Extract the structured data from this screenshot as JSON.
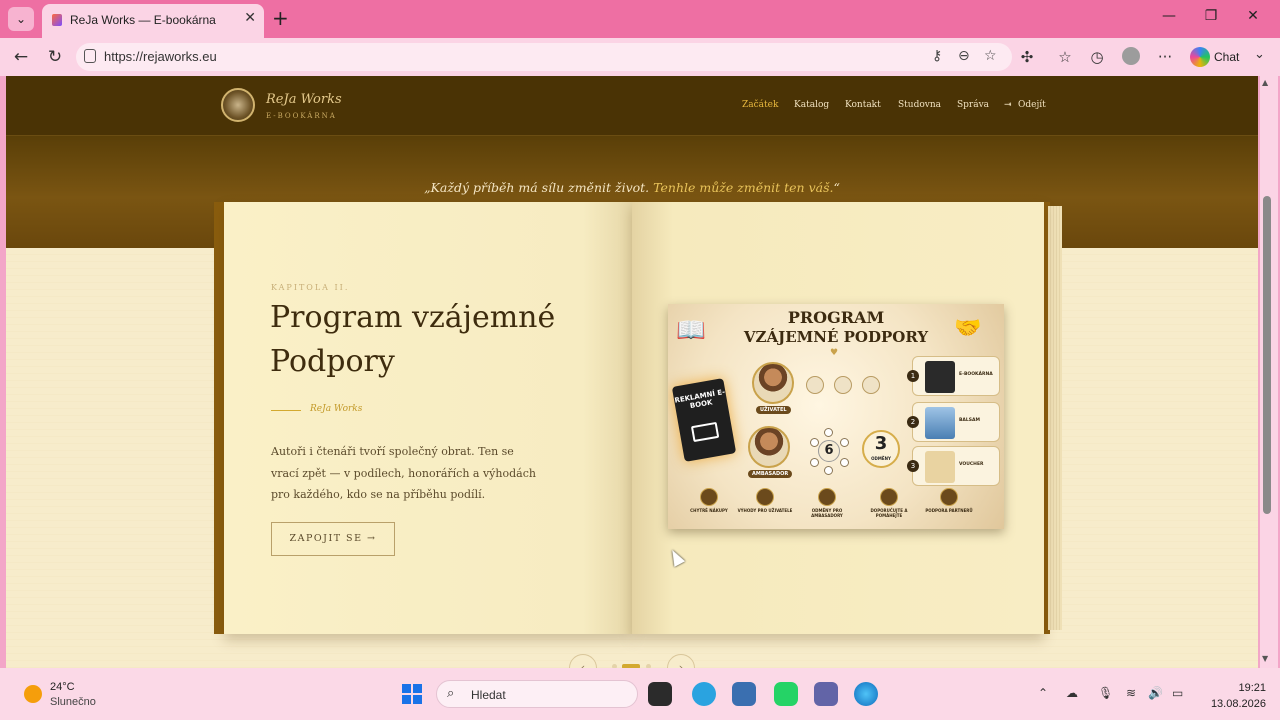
{
  "browser": {
    "tab_title": "ReJa Works — E-bookárna",
    "url": "https://rejaworks.eu",
    "chat_label": "Chat"
  },
  "site": {
    "brand": "ReJa Works",
    "brand_sub": "E-BOOKÁRNA",
    "nav": [
      "Začátek",
      "Katalog",
      "Kontakt",
      "Studovna",
      "Správa",
      "Odejít"
    ],
    "quote_main": "„Každý příběh má sílu změnit život.",
    "quote_highlight": "Tenhle může změnit ten váš.",
    "quote_end": "“"
  },
  "book": {
    "chapter": "KAPITOLA II.",
    "title_line1": "Program vzájemné",
    "title_line2": "Podpory",
    "byline": "ReJa Works",
    "description": "Autoři i čtenáři tvoří společný obrat. Ten se vrací zpět — v podílech, honorářích a výhodách pro každého, kdo se na příběhu podílí.",
    "cta": "ZAPOJIT SE →"
  },
  "infographic": {
    "title1": "PROGRAM",
    "title2": "VZÁJEMNÉ PODPORY",
    "ebook": "REKLAMNÍ E-BOOK",
    "user": "UŽIVATEL",
    "ambassador": "AMBASADOR",
    "six": "6",
    "three": "3",
    "three_label": "ODMĚNY",
    "rewards": [
      {
        "n": "1",
        "label": "E-BOOKÁRNA"
      },
      {
        "n": "2",
        "label": "BALSAM"
      },
      {
        "n": "3",
        "label": "VOUCHER"
      }
    ],
    "bottom": [
      "CHYTRÉ NÁKUPY",
      "VÝHODY PRO UŽIVATELE",
      "ODMĚNY PRO AMBASADORY",
      "DOPORUČUJTE A POMÁHEJTE",
      "PODPORA PARTNERŮ"
    ]
  },
  "taskbar": {
    "temp": "24°C",
    "condition": "Slunečno",
    "search": "Hledat",
    "time": "19:21",
    "date": "13.08.2026"
  },
  "colors": {
    "accent_gold": "#d3a92f",
    "header_brown": "#4a3305",
    "tab_pink": "#ee6fa3"
  },
  "pager": {
    "active_index": 1,
    "count": 3
  }
}
